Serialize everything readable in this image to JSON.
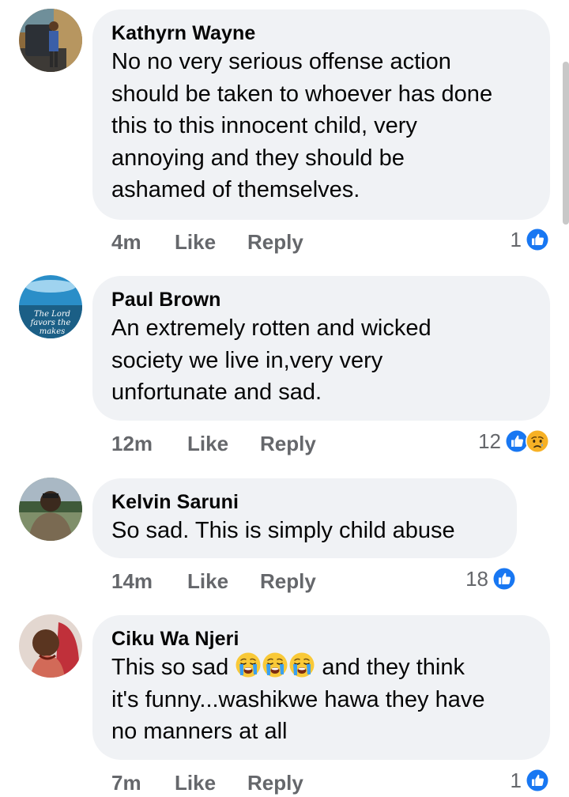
{
  "comments": [
    {
      "author": "Kathyrn Wayne",
      "lines": [
        "No no very serious offense action",
        "should be taken to whoever has done",
        "this to this innocent child, very",
        "annoying and they should be",
        "ashamed of themselves."
      ],
      "time": "4m",
      "like": "Like",
      "reply": "Reply",
      "reaction_count": "1",
      "reactions": [
        "like-icon"
      ]
    },
    {
      "author": "Paul Brown",
      "avatar_text": [
        "The Lord",
        "favors the",
        "makes"
      ],
      "lines": [
        "An extremely rotten and wicked",
        "society we live in,very very",
        "unfortunate and sad."
      ],
      "time": "12m",
      "like": "Like",
      "reply": "Reply",
      "reaction_count": "12",
      "reactions": [
        "like-icon",
        "sad-icon"
      ]
    },
    {
      "author": "Kelvin Saruni",
      "lines": [
        "So sad. This is simply child abuse"
      ],
      "time": "14m",
      "like": "Like",
      "reply": "Reply",
      "reaction_count": "18",
      "reactions": [
        "like-icon"
      ]
    },
    {
      "author": "Ciku Wa Njeri",
      "line1_before": "This so sad",
      "line1_after": "and they think",
      "line1_emojis": [
        "crying-face-emoji",
        "crying-face-emoji",
        "crying-face-emoji"
      ],
      "lines": [
        "it's funny...washikwe hawa they have",
        "no manners at all"
      ],
      "time": "7m",
      "like": "Like",
      "reply": "Reply",
      "reaction_count": "1",
      "reactions": [
        "like-icon"
      ]
    }
  ],
  "colors": {
    "bubble": "#f0f2f5",
    "meta_text": "#65676b",
    "like_blue": "#1877f2",
    "sad_yellow": "#f7b125"
  }
}
